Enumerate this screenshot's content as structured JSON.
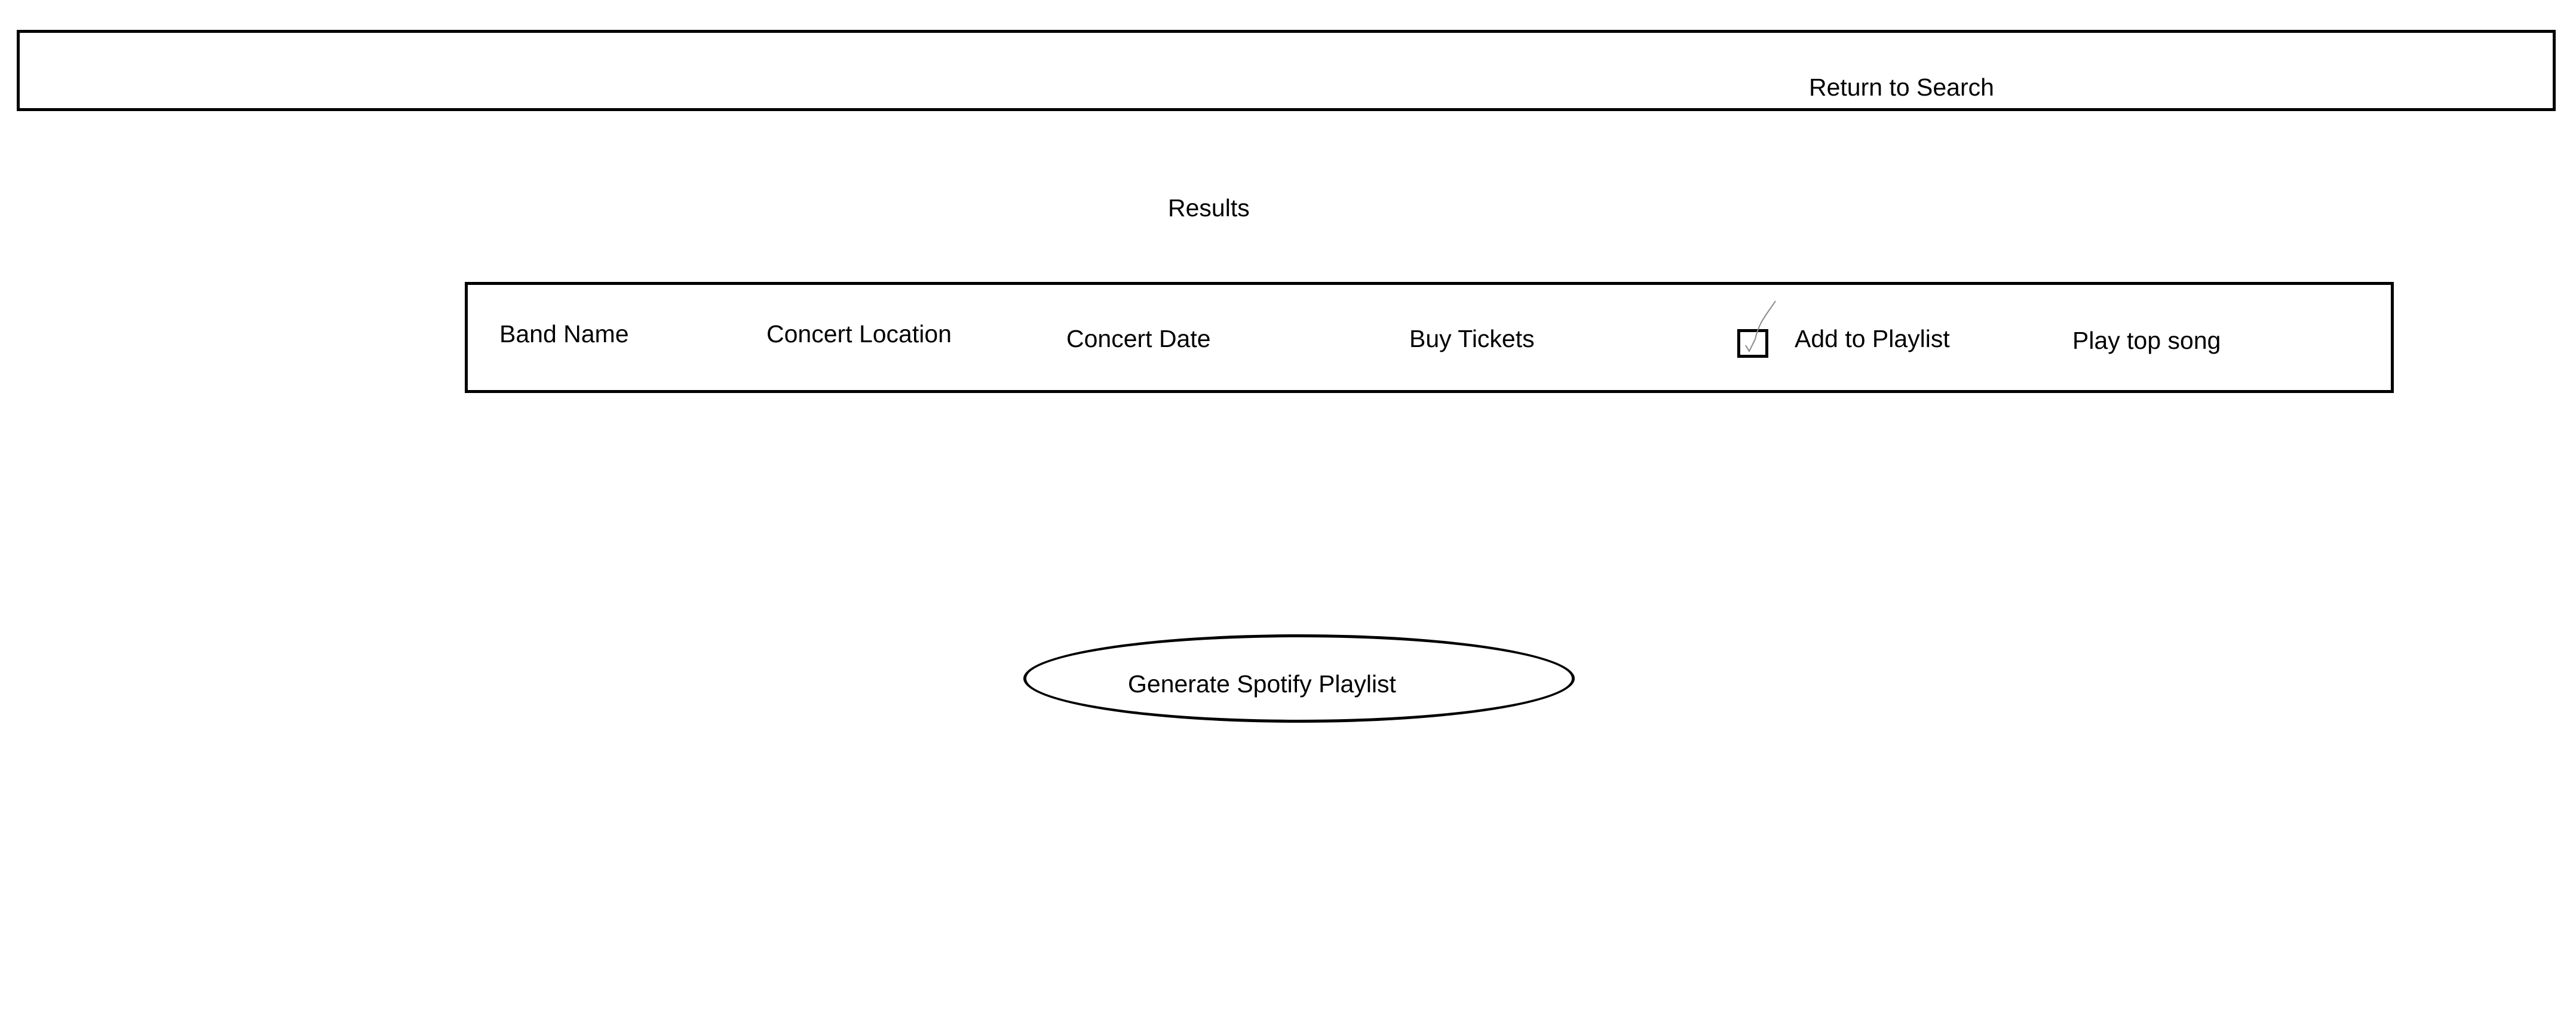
{
  "header": {
    "return_label": "Return to Search"
  },
  "results": {
    "title": "Results",
    "row": {
      "band_name": "Band Name",
      "concert_location": "Concert Location",
      "concert_date": "Concert Date",
      "buy_tickets": "Buy Tickets",
      "add_to_playlist_checked": true,
      "add_to_playlist": "Add to Playlist",
      "play_top_song": "Play top song"
    }
  },
  "actions": {
    "generate_label": "Generate Spotify Playlist"
  },
  "icons": {
    "checkbox": "checkmark-icon"
  },
  "colors": {
    "stroke": "#000000",
    "background": "#ffffff",
    "checkmark": "#8a8a8a"
  }
}
